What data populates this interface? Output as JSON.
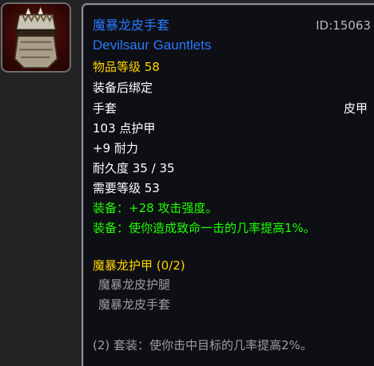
{
  "icon": {
    "name": "gauntlet-icon"
  },
  "tooltip": {
    "item_name_cn": "魔暴龙皮手套",
    "item_id": "ID:15063",
    "item_name_en": "Devilsaur Gauntlets",
    "item_level": "物品等级 58",
    "binding": "装备后绑定",
    "slot": "手套",
    "armor_type": "皮甲",
    "armor": "103 点护甲",
    "stamina": "+9 耐力",
    "durability": "耐久度 35 / 35",
    "required_level": "需要等级 53",
    "equip_1": "装备：+28 攻击强度。",
    "equip_2": "装备：使你造成致命一击的几率提高1%。",
    "set_name": "魔暴龙护甲 (0/2)",
    "set_items": [
      "魔暴龙皮护腿",
      "魔暴龙皮手套"
    ],
    "set_bonus": "(2) 套装：使你击中目标的几率提高2%。"
  },
  "colors": {
    "epic_name": "#2b78ff",
    "item_level": "#ffd100",
    "equip_effect": "#1eff00",
    "set_gray": "#9d9d9d",
    "frame": "#8f8f95"
  }
}
